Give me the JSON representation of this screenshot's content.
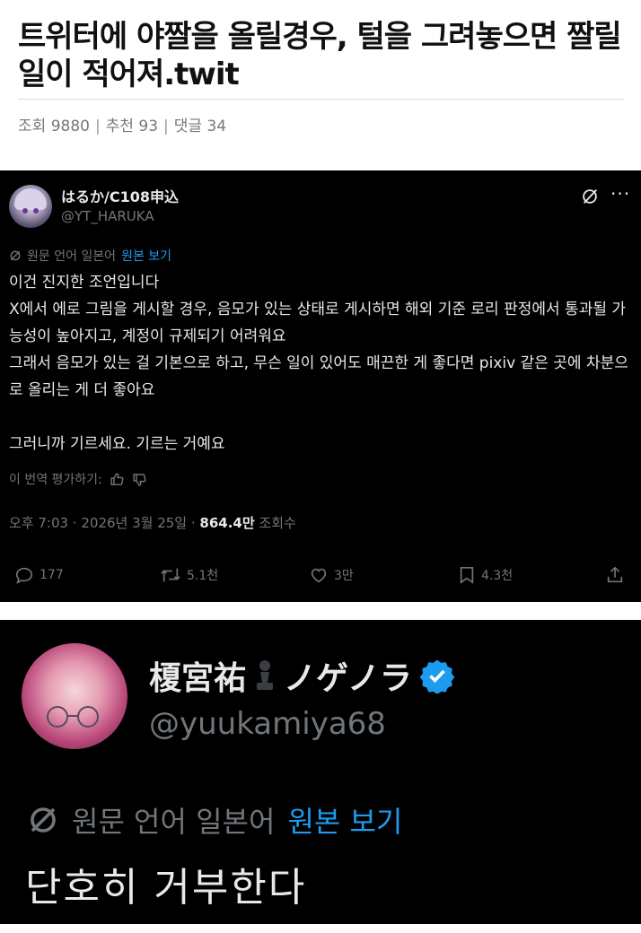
{
  "post": {
    "title": "트위터에 야짤을 올릴경우, 털을 그려놓으면 짤릴 일이 적어져.twit",
    "views_label": "조회",
    "views": "9880",
    "recommend_label": "추천",
    "recommend": "93",
    "comments_label": "댓글",
    "comments": "34",
    "separator": "|"
  },
  "tweet1": {
    "name": "はるか/C108申込",
    "handle": "@YT_HARUKA",
    "more": "···",
    "translation_notice": "원문 언어 일본어",
    "view_original": "원본 보기",
    "body": "이건 진지한 조언입니다\nX에서 에로 그림을 게시할 경우, 음모가 있는 상태로 게시하면 해외 기준 로리 판정에서 통과될 가능성이 높아지고, 계정이 규제되기 어려워요\n그래서 음모가 있는 걸 기본으로 하고, 무슨 일이 있어도 매끈한 게 좋다면 pixiv 같은 곳에 차분으로 올리는 게 더 좋아요\n\n그러니까 기르세요. 기르는 거예요",
    "rate_translation": "이 번역 평가하기:",
    "time": "오후 7:03 · 2026년 3월 25일 · ",
    "views_count": "864.4만",
    "views_suffix": " 조회수",
    "replies": "177",
    "retweets": "5.1천",
    "likes": "3만",
    "bookmarks": "4.3천",
    "icons": [
      "grok-icon",
      "more-icon",
      "translate-icon",
      "thumbs-up-icon",
      "thumbs-down-icon",
      "reply-icon",
      "retweet-icon",
      "like-icon",
      "bookmark-icon",
      "share-icon"
    ]
  },
  "tweet2": {
    "name": "榎宮祐",
    "name_suffix": "ノゲノラ",
    "handle": "@yuukamiya68",
    "translation_notice": "원문 언어 일본어",
    "view_original": "원본 보기",
    "body": "단호히 거부한다",
    "icons": [
      "pawn-icon",
      "verified-badge-icon",
      "translate-icon"
    ]
  },
  "colors": {
    "tweet_bg": "#000000",
    "text_primary": "#e7e9ea",
    "text_secondary": "#71767b",
    "link": "#1d9bf0",
    "verified": "#1d9bf0"
  }
}
